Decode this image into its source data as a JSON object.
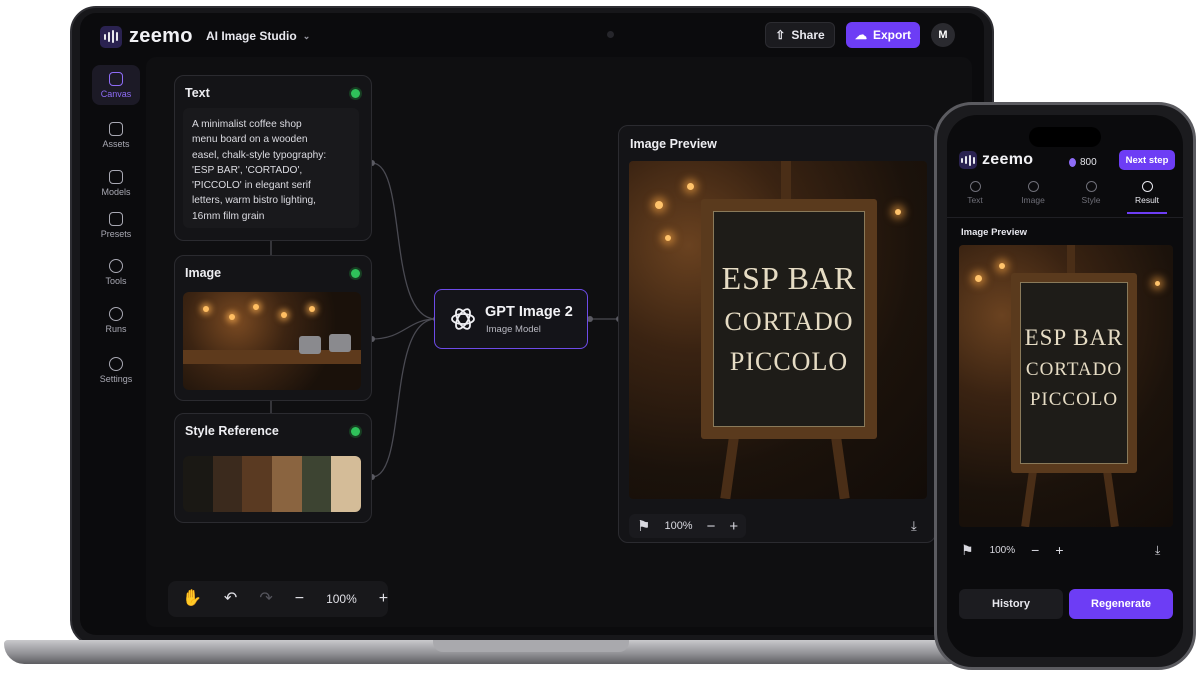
{
  "app": {
    "brand": "zeemo",
    "project_name": "AI Image Studio",
    "share_label": "Share",
    "export_label": "Export",
    "avatar_initial": "M",
    "accent_color": "#6d3df5"
  },
  "sidebar": {
    "items": [
      {
        "label": "Canvas",
        "icon": "canvas-icon",
        "active": true
      },
      {
        "label": "Assets",
        "icon": "assets-icon"
      },
      {
        "label": "Models",
        "icon": "models-icon"
      },
      {
        "label": "Presets",
        "icon": "presets-icon"
      },
      {
        "label": "Tools",
        "icon": "tools-icon"
      },
      {
        "label": "Runs",
        "icon": "runs-icon"
      },
      {
        "label": "Settings",
        "icon": "settings-icon"
      }
    ]
  },
  "nodes": {
    "text": {
      "title": "Text",
      "prompt_lines": [
        "A minimalist coffee shop",
        "menu board on a wooden",
        "easel, chalk-style typography:",
        "'ESP BAR', 'CORTADO',",
        "'PICCOLO' in elegant serif",
        "letters, warm bistro lighting,",
        "16mm film grain"
      ]
    },
    "image": {
      "title": "Image"
    },
    "style": {
      "title": "Style Reference",
      "swatches": [
        "#1a1814",
        "#3b2a1d",
        "#5a3a22",
        "#8a6440",
        "#3d4432",
        "#d4bc98"
      ]
    },
    "model": {
      "name": "GPT Image 2",
      "subtitle": "Image Model"
    },
    "preview": {
      "title": "Image Preview",
      "zoom": "100%",
      "board_lines": [
        "ESP BAR",
        "CORTADO",
        "PICCOLO"
      ]
    }
  },
  "toolbar": {
    "zoom": "100%"
  },
  "phone": {
    "brand": "zeemo",
    "credits": "800",
    "next_step_label": "Next step",
    "tabs": [
      {
        "label": "Text"
      },
      {
        "label": "Image"
      },
      {
        "label": "Style"
      },
      {
        "label": "Result",
        "active": true
      }
    ],
    "preview_title": "Image Preview",
    "zoom": "100%",
    "history_label": "History",
    "regenerate_label": "Regenerate"
  }
}
